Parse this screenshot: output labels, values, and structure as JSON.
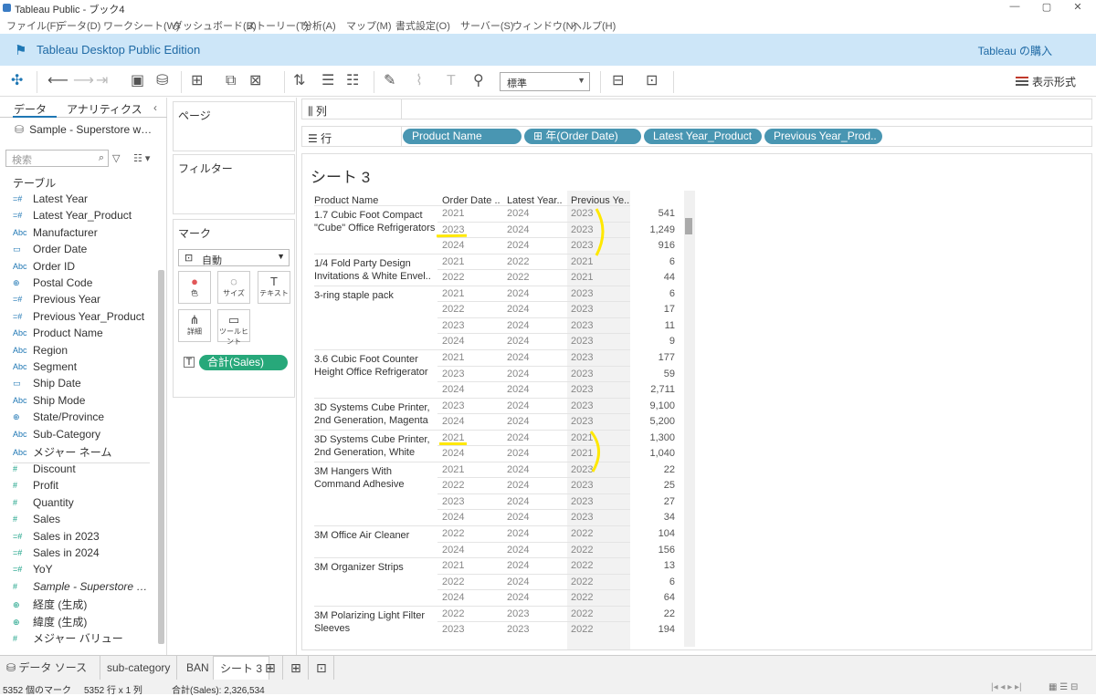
{
  "window": {
    "title": "Tableau Public - ブック4",
    "controls": [
      "—",
      "▢",
      "✕"
    ]
  },
  "menu": [
    "ファイル(F)",
    "データ(D)",
    "ワークシート(W)",
    "ダッシュボード(B)",
    "ストーリー(T)",
    "分析(A)",
    "マップ(M)",
    "書式設定(O)",
    "サーバー(S)",
    "ウィンドウ(N)",
    "ヘルプ(H)"
  ],
  "banner": {
    "title": "Tableau Desktop Public Edition",
    "buy": "Tableau の購入"
  },
  "toolbar": {
    "fit_select": "標準",
    "show_me": "表示形式"
  },
  "datapane": {
    "tabs": {
      "data": "データ",
      "analytics": "アナリティクス"
    },
    "source": "Sample - Superstore w…",
    "search_placeholder": "検索",
    "section": "テーブル",
    "dimensions": [
      {
        "icon": "=#",
        "label": "Latest Year"
      },
      {
        "icon": "=#",
        "label": "Latest Year_Product"
      },
      {
        "icon": "Abc",
        "label": "Manufacturer"
      },
      {
        "icon": "▭",
        "label": "Order Date"
      },
      {
        "icon": "Abc",
        "label": "Order ID"
      },
      {
        "icon": "⊕",
        "label": "Postal Code"
      },
      {
        "icon": "=#",
        "label": "Previous Year"
      },
      {
        "icon": "=#",
        "label": "Previous Year_Product"
      },
      {
        "icon": "Abc",
        "label": "Product Name"
      },
      {
        "icon": "Abc",
        "label": "Region"
      },
      {
        "icon": "Abc",
        "label": "Segment"
      },
      {
        "icon": "▭",
        "label": "Ship Date"
      },
      {
        "icon": "Abc",
        "label": "Ship Mode"
      },
      {
        "icon": "⊕",
        "label": "State/Province"
      },
      {
        "icon": "Abc",
        "label": "Sub-Category"
      },
      {
        "icon": "Abc",
        "label": "メジャー ネーム"
      }
    ],
    "measures": [
      {
        "icon": "#",
        "label": "Discount"
      },
      {
        "icon": "#",
        "label": "Profit"
      },
      {
        "icon": "#",
        "label": "Quantity"
      },
      {
        "icon": "#",
        "label": "Sales"
      },
      {
        "icon": "=#",
        "label": "Sales in 2023"
      },
      {
        "icon": "=#",
        "label": "Sales in 2024"
      },
      {
        "icon": "=#",
        "label": "YoY"
      },
      {
        "icon": "#",
        "label": "Sample - Superstore …"
      },
      {
        "icon": "⊕",
        "label": "経度 (生成)"
      },
      {
        "icon": "⊕",
        "label": "緯度 (生成)"
      },
      {
        "icon": "#",
        "label": "メジャー バリュー"
      }
    ]
  },
  "shelves": {
    "pages": "ページ",
    "filters": "フィルター",
    "marks": "マーク",
    "mark_type": "自動",
    "mark_buttons": [
      {
        "glyph": "●",
        "label": "色"
      },
      {
        "glyph": "◌",
        "label": "サイズ"
      },
      {
        "glyph": "T",
        "label": "テキスト"
      },
      {
        "glyph": "⋔",
        "label": "詳細"
      },
      {
        "glyph": "▭",
        "label": "ツールヒント"
      }
    ],
    "mark_pill": "合計(Sales)",
    "columns_label": "列",
    "rows_label": "行",
    "row_pills": [
      "Product Name",
      "⊞ 年(Order Date)",
      "Latest Year_Product",
      "Previous Year_Prod.."
    ]
  },
  "view": {
    "title": "シート 3",
    "headers": [
      "Product Name",
      "Order Date ..",
      "Latest Year..",
      "Previous Ye.."
    ],
    "products": [
      {
        "name": "1.7 Cubic Foot Compact \"Cube\" Office Refrigerators",
        "rows": [
          [
            "2021",
            "2024",
            "2023",
            "541"
          ],
          [
            "2023",
            "2024",
            "2023",
            "1,249"
          ],
          [
            "2024",
            "2024",
            "2023",
            "916"
          ]
        ]
      },
      {
        "name": "1/4 Fold Party Design Invitations & White Envel..",
        "rows": [
          [
            "2021",
            "2022",
            "2021",
            "6"
          ],
          [
            "2022",
            "2022",
            "2021",
            "44"
          ]
        ]
      },
      {
        "name": "3-ring staple pack",
        "rows": [
          [
            "2021",
            "2024",
            "2023",
            "6"
          ],
          [
            "2022",
            "2024",
            "2023",
            "17"
          ],
          [
            "2023",
            "2024",
            "2023",
            "11"
          ],
          [
            "2024",
            "2024",
            "2023",
            "9"
          ]
        ]
      },
      {
        "name": "3.6 Cubic Foot Counter Height Office Refrigerator",
        "rows": [
          [
            "2021",
            "2024",
            "2023",
            "177"
          ],
          [
            "2023",
            "2024",
            "2023",
            "59"
          ],
          [
            "2024",
            "2024",
            "2023",
            "2,711"
          ]
        ]
      },
      {
        "name": "3D Systems Cube Printer, 2nd Generation, Magenta",
        "rows": [
          [
            "2023",
            "2024",
            "2023",
            "9,100"
          ],
          [
            "2024",
            "2024",
            "2023",
            "5,200"
          ]
        ]
      },
      {
        "name": "3D Systems Cube Printer, 2nd Generation, White",
        "rows": [
          [
            "2021",
            "2024",
            "2021",
            "1,300"
          ],
          [
            "2024",
            "2024",
            "2021",
            "1,040"
          ]
        ]
      },
      {
        "name": "3M Hangers With Command Adhesive",
        "rows": [
          [
            "2021",
            "2024",
            "2023",
            "22"
          ],
          [
            "2022",
            "2024",
            "2023",
            "25"
          ],
          [
            "2023",
            "2024",
            "2023",
            "27"
          ],
          [
            "2024",
            "2024",
            "2023",
            "34"
          ]
        ]
      },
      {
        "name": "3M Office Air Cleaner",
        "rows": [
          [
            "2022",
            "2024",
            "2022",
            "104"
          ],
          [
            "2024",
            "2024",
            "2022",
            "156"
          ]
        ]
      },
      {
        "name": "3M Organizer Strips",
        "rows": [
          [
            "2021",
            "2024",
            "2022",
            "13"
          ],
          [
            "2022",
            "2024",
            "2022",
            "6"
          ],
          [
            "2024",
            "2024",
            "2022",
            "64"
          ]
        ]
      },
      {
        "name": "3M Polarizing Light Filter Sleeves",
        "rows": [
          [
            "2022",
            "2023",
            "2022",
            "22"
          ],
          [
            "2023",
            "2023",
            "2022",
            "194"
          ]
        ]
      }
    ]
  },
  "tabs": {
    "datasource": "データ ソース",
    "sheets": [
      "sub-category",
      "BAN",
      "シート 3"
    ]
  },
  "status": {
    "marks": "5352 個のマーク",
    "rows": "5352 行 x 1 列",
    "sum": "合計(Sales): 2,326,534"
  }
}
